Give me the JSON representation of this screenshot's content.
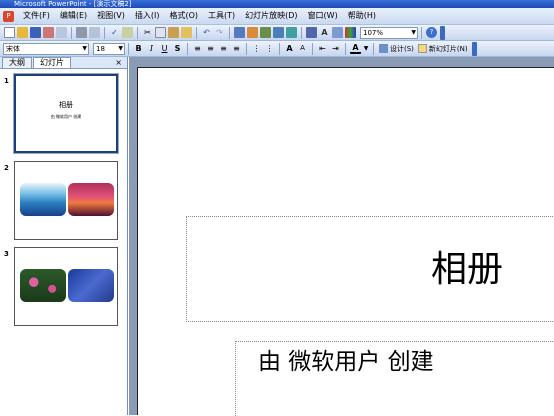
{
  "window": {
    "title": "Microsoft PowerPoint - [演示文稿2]"
  },
  "menubar": {
    "items": [
      "文件(F)",
      "编辑(E)",
      "视图(V)",
      "插入(I)",
      "格式(O)",
      "工具(T)",
      "幻灯片放映(D)",
      "窗口(W)",
      "帮助(H)"
    ]
  },
  "toolbar": {
    "zoom": "107%",
    "font": "宋体",
    "size": "18",
    "bold": "B",
    "italic": "I",
    "underline": "U",
    "shadow": "S",
    "design_label": "设计(S)",
    "new_slide_label": "新幻灯片(N)"
  },
  "panel": {
    "tabs": [
      "大纲",
      "幻灯片"
    ],
    "close": "×"
  },
  "slides": [
    {
      "number": "1",
      "title": "相册",
      "subtitle": "由 微软用户 创建"
    },
    {
      "number": "2"
    },
    {
      "number": "3"
    }
  ],
  "main_slide": {
    "title": "相册",
    "subtitle": "由 微软用户 创建"
  }
}
